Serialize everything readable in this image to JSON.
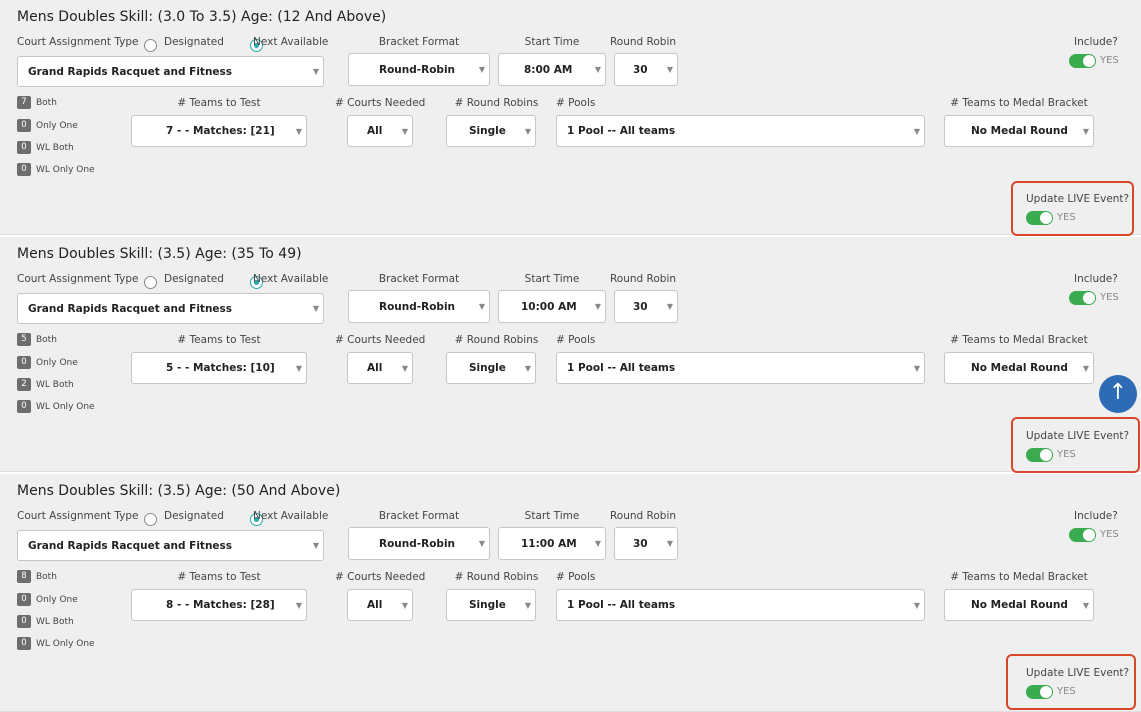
{
  "labels": {
    "court_assignment_type": "Court Assignment Type",
    "designated": "Designated",
    "next_available": "Next Available",
    "bracket_format": "Bracket Format",
    "start_time": "Start Time",
    "round_robin": "Round Robin",
    "include": "Include?",
    "yes": "YES",
    "teams_to_test": "# Teams to Test",
    "courts_needed": "# Courts Needed",
    "round_robins": "# Round Robins",
    "pools": "# Pools",
    "teams_to_medal": "# Teams to Medal Bracket",
    "update_live": "Update LIVE Event?",
    "both": "Both",
    "only_one": "Only One",
    "wl_both": "WL Both",
    "wl_only_one": "WL Only One"
  },
  "events": [
    {
      "title": "Mens Doubles Skill: (3.0 To 3.5) Age: (12 And Above)",
      "court_assignment": "Next Available",
      "facility": "Grand Rapids Racquet and Fitness",
      "bracket_format": "Round-Robin",
      "start_time": "8:00 AM",
      "round_robin": "30",
      "teams_to_test": "7 - - Matches: [21]",
      "courts_needed": "All",
      "round_robins": "Single",
      "pools": "1 Pool -- All teams",
      "medal": "No Medal Round",
      "stats": {
        "both": "7",
        "only_one": "0",
        "wl_both": "0",
        "wl_only_one": "0"
      },
      "include": true,
      "update_live": true
    },
    {
      "title": "Mens Doubles Skill: (3.5) Age: (35 To 49)",
      "court_assignment": "Next Available",
      "facility": "Grand Rapids Racquet and Fitness",
      "bracket_format": "Round-Robin",
      "start_time": "10:00 AM",
      "round_robin": "30",
      "teams_to_test": "5 - - Matches: [10]",
      "courts_needed": "All",
      "round_robins": "Single",
      "pools": "1 Pool -- All teams",
      "medal": "No Medal Round",
      "stats": {
        "both": "5",
        "only_one": "0",
        "wl_both": "2",
        "wl_only_one": "0"
      },
      "include": true,
      "update_live": true
    },
    {
      "title": "Mens Doubles Skill: (3.5) Age: (50 And Above)",
      "court_assignment": "Next Available",
      "facility": "Grand Rapids Racquet and Fitness",
      "bracket_format": "Round-Robin",
      "start_time": "11:00 AM",
      "round_robin": "30",
      "teams_to_test": "8 - - Matches: [28]",
      "courts_needed": "All",
      "round_robins": "Single",
      "pools": "1 Pool -- All teams",
      "medal": "No Medal Round",
      "stats": {
        "both": "8",
        "only_one": "0",
        "wl_both": "0",
        "wl_only_one": "0"
      },
      "include": true,
      "update_live": true
    }
  ],
  "scroll_top_icon": "arrow-up-icon",
  "colors": {
    "toggle_on": "#3aab4f",
    "highlight": "#d9472b",
    "radio_on": "#2aa8b0",
    "fab": "#2e6bb5"
  }
}
